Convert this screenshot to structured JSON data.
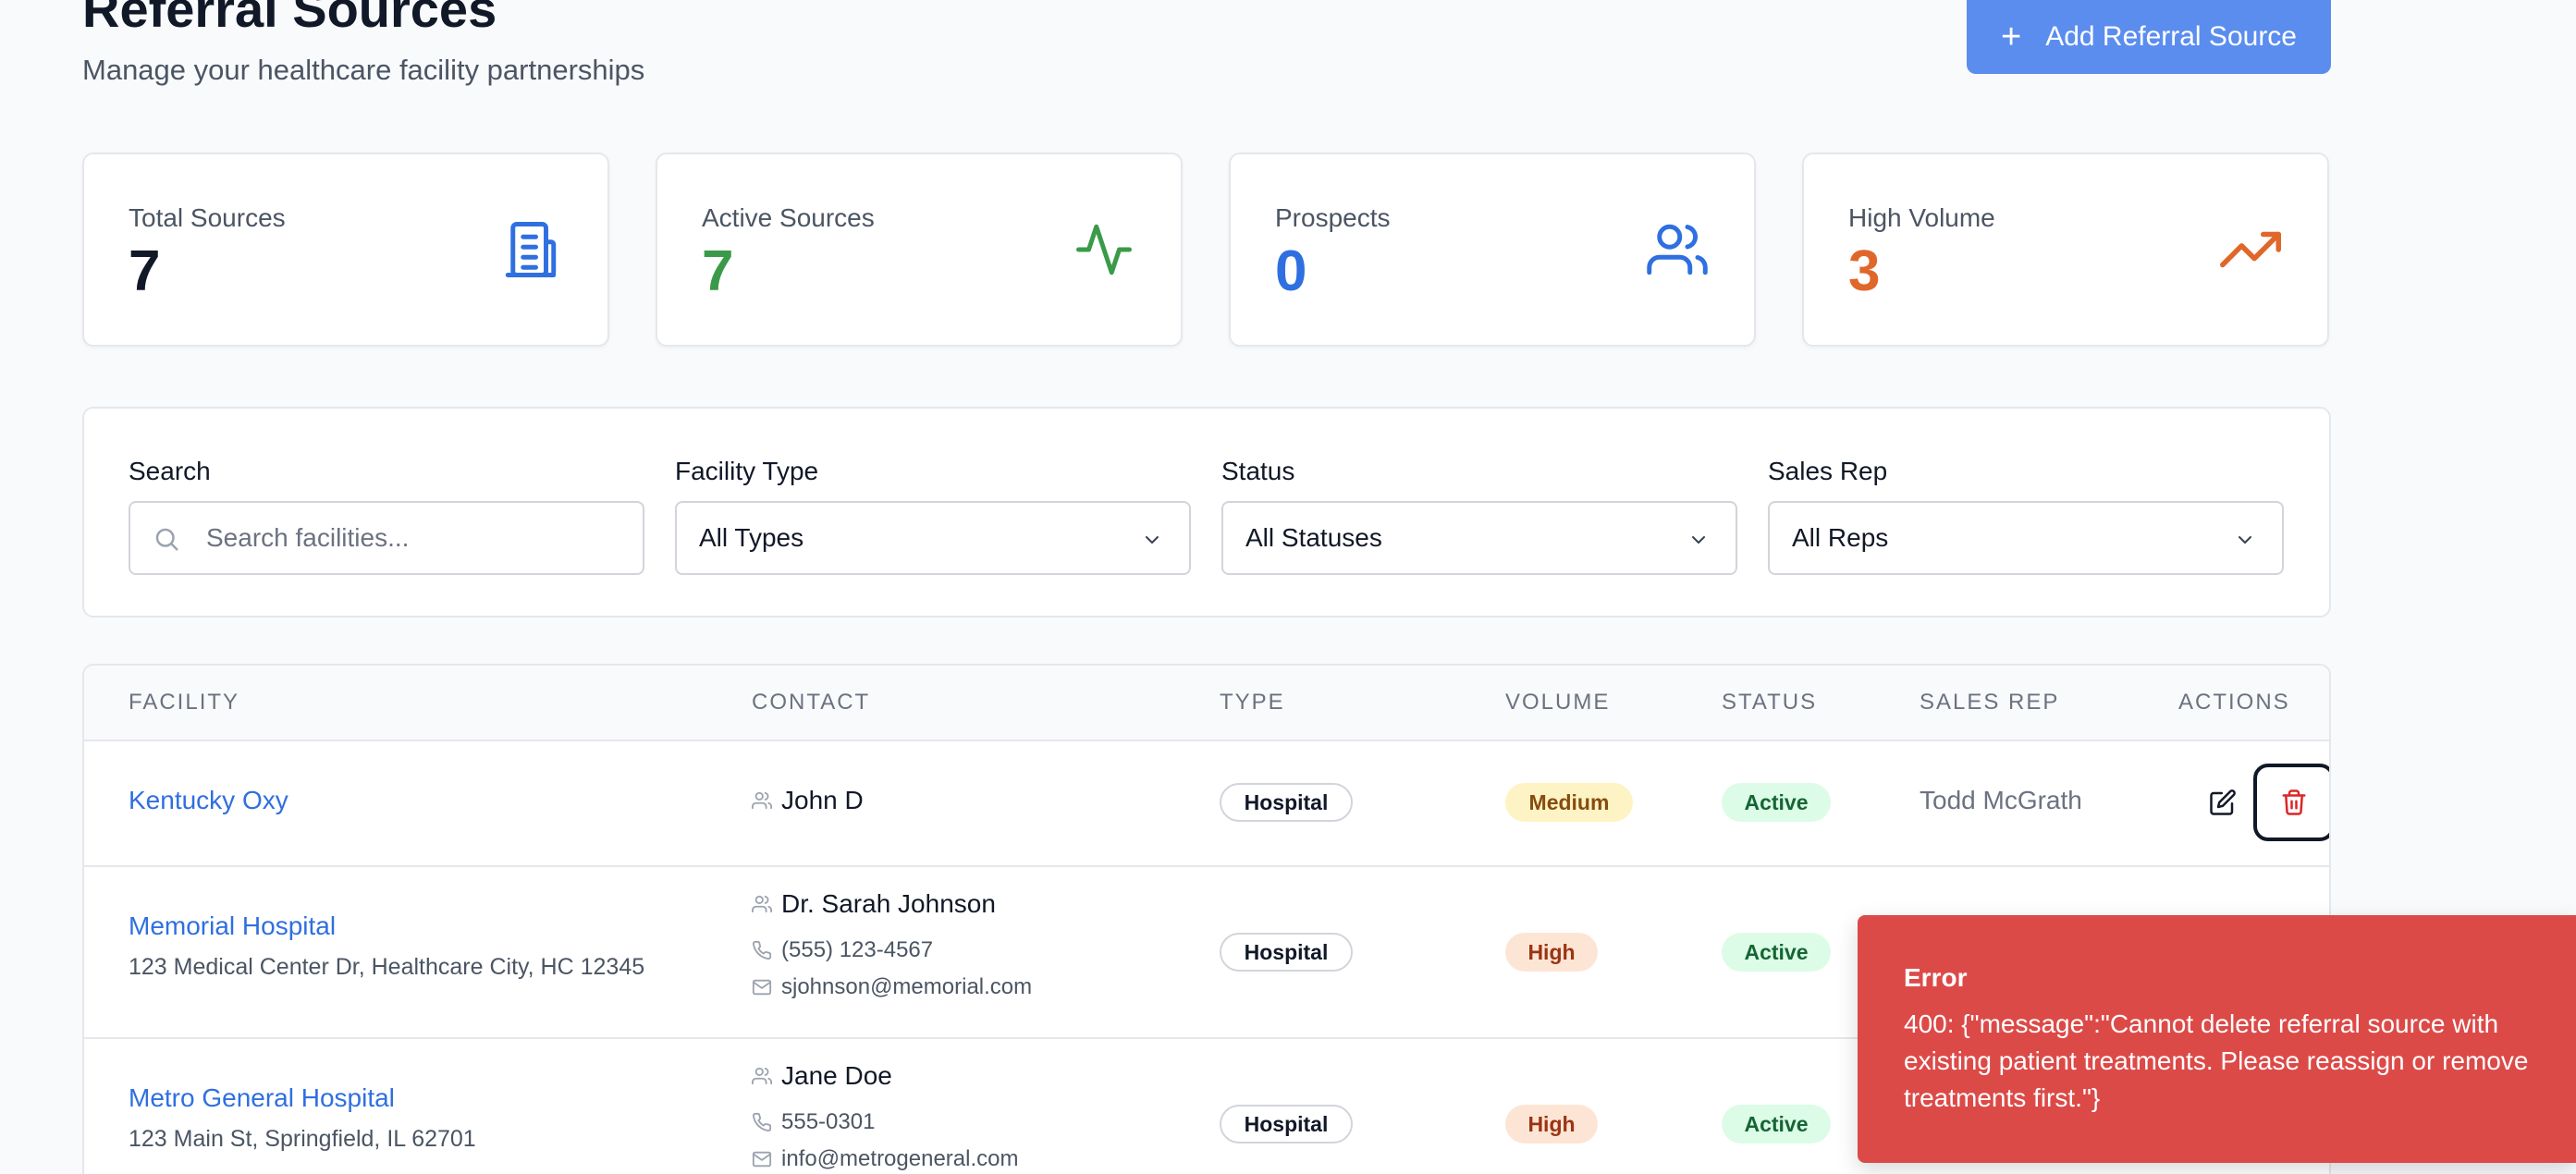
{
  "header": {
    "title": "Referral Sources",
    "subtitle": "Manage your healthcare facility partnerships",
    "add_button_label": "Add Referral Source"
  },
  "stats": [
    {
      "label": "Total Sources",
      "value": "7",
      "icon": "building-icon",
      "color": "#111827",
      "icon_color": "#2f6fe0"
    },
    {
      "label": "Active Sources",
      "value": "7",
      "icon": "activity-icon",
      "color": "#3a9a49",
      "icon_color": "#3a9a49"
    },
    {
      "label": "Prospects",
      "value": "0",
      "icon": "users-icon",
      "color": "#2f6fe0",
      "icon_color": "#2f6fe0"
    },
    {
      "label": "High Volume",
      "value": "3",
      "icon": "trending-up-icon",
      "color": "#e0672a",
      "icon_color": "#e0672a"
    }
  ],
  "filters": {
    "search": {
      "label": "Search",
      "placeholder": "Search facilities..."
    },
    "facility_type": {
      "label": "Facility Type",
      "value": "All Types"
    },
    "status": {
      "label": "Status",
      "value": "All Statuses"
    },
    "sales_rep": {
      "label": "Sales Rep",
      "value": "All Reps"
    }
  },
  "table": {
    "columns": [
      "FACILITY",
      "CONTACT",
      "TYPE",
      "VOLUME",
      "STATUS",
      "SALES REP",
      "ACTIONS"
    ],
    "rows": [
      {
        "facility": "Kentucky Oxy",
        "address": "",
        "contact_name": "John D",
        "phone": "",
        "email": "",
        "type": "Hospital",
        "volume": "Medium",
        "status": "Active",
        "sales_rep": "Todd McGrath"
      },
      {
        "facility": "Memorial Hospital",
        "address": "123 Medical Center Dr, Healthcare City, HC 12345",
        "contact_name": "Dr. Sarah Johnson",
        "phone": "(555) 123-4567",
        "email": "sjohnson@memorial.com",
        "type": "Hospital",
        "volume": "High",
        "status": "Active",
        "sales_rep": ""
      },
      {
        "facility": "Metro General Hospital",
        "address": "123 Main St, Springfield, IL 62701",
        "contact_name": "Jane Doe",
        "phone": "555-0301",
        "email": "info@metrogeneral.com",
        "type": "Hospital",
        "volume": "High",
        "status": "Active",
        "sales_rep": ""
      }
    ]
  },
  "toast": {
    "title": "Error",
    "message": "400: {\"message\":\"Cannot delete referral source with existing patient treatments. Please reassign or remove treatments first.\"}"
  },
  "colors": {
    "accent": "#5b8def",
    "link": "#2f6fe0",
    "error": "#dc4a48"
  }
}
